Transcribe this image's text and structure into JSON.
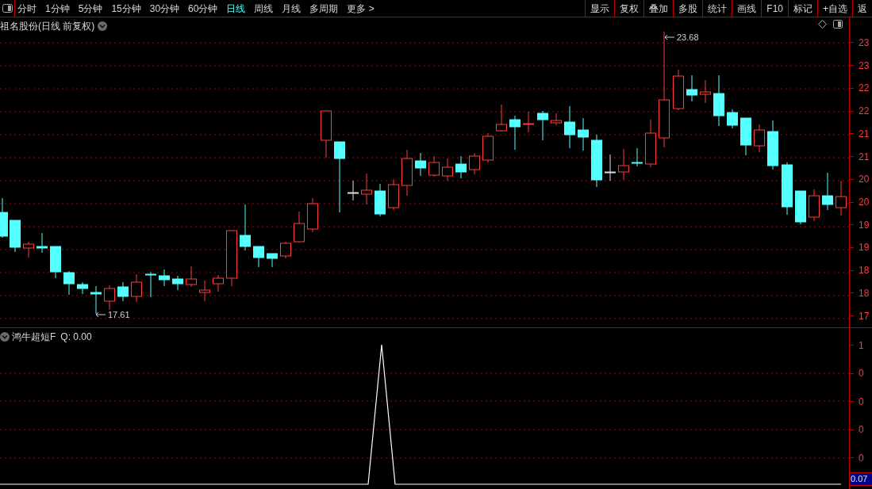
{
  "toolbar": {
    "periods": [
      {
        "label": "分时",
        "selected": false
      },
      {
        "label": "1分钟",
        "selected": false
      },
      {
        "label": "5分钟",
        "selected": false
      },
      {
        "label": "15分钟",
        "selected": false
      },
      {
        "label": "30分钟",
        "selected": false
      },
      {
        "label": "60分钟",
        "selected": false
      },
      {
        "label": "日线",
        "selected": true
      },
      {
        "label": "周线",
        "selected": false
      },
      {
        "label": "月线",
        "selected": false
      },
      {
        "label": "多周期",
        "selected": false
      },
      {
        "label": "更多 >",
        "selected": false
      }
    ],
    "buttons": [
      "显示",
      "复权",
      "叠加",
      "多股",
      "统计",
      "画线",
      "F10",
      "标记",
      "+自选",
      "返"
    ]
  },
  "main_chart": {
    "title": "祖名股份(日线 前复权)",
    "high_label": "23.68",
    "low_label": "17.61",
    "y_labels": [
      "23",
      "23",
      "22",
      "22",
      "21",
      "21",
      "20",
      "20",
      "19",
      "19",
      "18",
      "18",
      "17"
    ]
  },
  "indicator": {
    "title": "鸿牛超短F",
    "reading": "Q: 0.00",
    "y_labels": [
      "1",
      "0",
      "0",
      "0",
      "0"
    ],
    "current_value": "0.07"
  }
}
